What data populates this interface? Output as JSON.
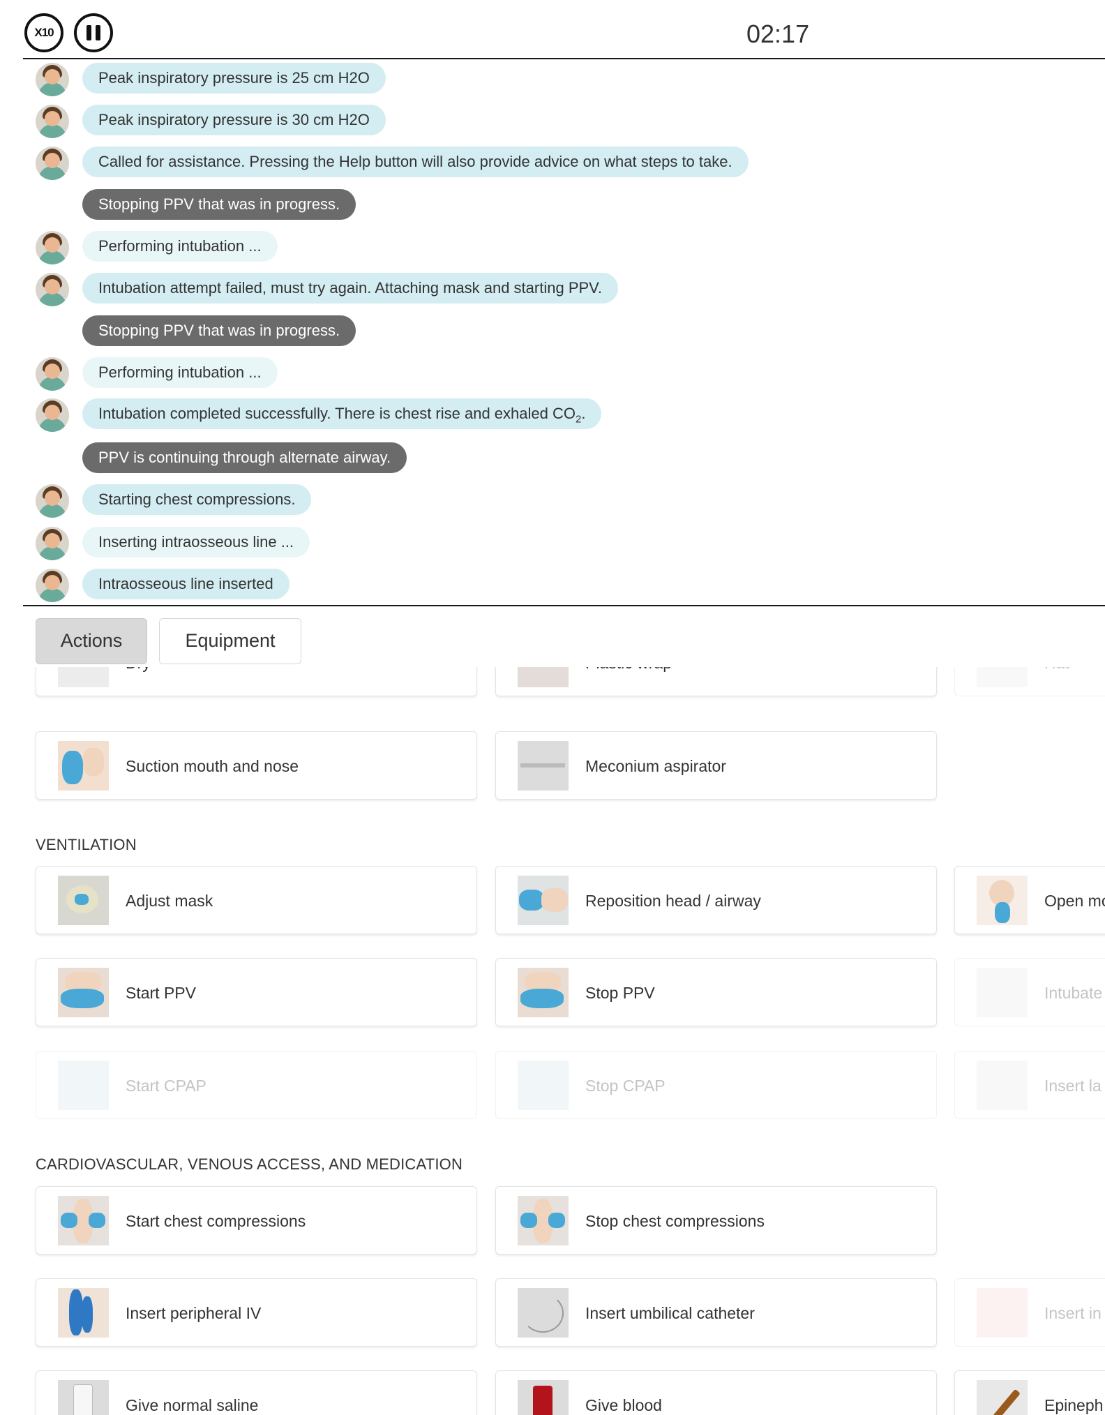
{
  "header": {
    "speed_label": "X10",
    "timer": "02:17"
  },
  "log": [
    {
      "speaker": "avatar",
      "style": "light",
      "text": "Peak inspiratory pressure is 25 cm H2O"
    },
    {
      "speaker": "avatar",
      "style": "light",
      "text": "Peak inspiratory pressure is 30 cm H2O"
    },
    {
      "speaker": "avatar",
      "style": "light",
      "text": "Called for assistance. Pressing the Help button will also provide advice on what steps to take."
    },
    {
      "speaker": "system",
      "style": "dark",
      "text": "Stopping PPV that was in progress."
    },
    {
      "speaker": "avatar",
      "style": "pale",
      "text": "Performing intubation ..."
    },
    {
      "speaker": "avatar",
      "style": "light",
      "text": "Intubation attempt failed, must try again. Attaching mask and starting PPV."
    },
    {
      "speaker": "system",
      "style": "dark",
      "text": "Stopping PPV that was in progress."
    },
    {
      "speaker": "avatar",
      "style": "pale",
      "text": "Performing intubation ..."
    },
    {
      "speaker": "avatar",
      "style": "light",
      "text": "Intubation completed successfully. There is chest rise and exhaled CO",
      "sub": "2",
      "after": "."
    },
    {
      "speaker": "system",
      "style": "dark",
      "text": "PPV is continuing through alternate airway."
    },
    {
      "speaker": "avatar",
      "style": "light",
      "text": "Starting chest compressions."
    },
    {
      "speaker": "avatar",
      "style": "pale",
      "text": "Inserting intraosseous line ..."
    },
    {
      "speaker": "avatar",
      "style": "light",
      "text": "Intraosseous line inserted"
    }
  ],
  "tabs": {
    "actions": "Actions",
    "equipment": "Equipment"
  },
  "sections": {
    "ventilation": "VENTILATION",
    "cardio": "CARDIOVASCULAR, VENOUS ACCESS, AND MEDICATION"
  },
  "cards": {
    "dry": "Dry",
    "plastic_wrap": "Plastic wrap",
    "hat": "Hat",
    "suction": "Suction mouth and nose",
    "meconium": "Meconium aspirator",
    "adjust_mask": "Adjust mask",
    "reposition": "Reposition head / airway",
    "open_mouth": "Open mo",
    "start_ppv": "Start PPV",
    "stop_ppv": "Stop PPV",
    "intubate": "Intubate",
    "start_cpap": "Start CPAP",
    "stop_cpap": "Stop CPAP",
    "insert_la": "Insert la",
    "start_compressions": "Start chest compressions",
    "stop_compressions": "Stop chest compressions",
    "peripheral_iv": "Insert peripheral IV",
    "umbilical": "Insert umbilical catheter",
    "insert_in": "Insert in",
    "normal_saline": "Give normal saline",
    "give_blood": "Give blood",
    "epineph": "Epineph"
  }
}
